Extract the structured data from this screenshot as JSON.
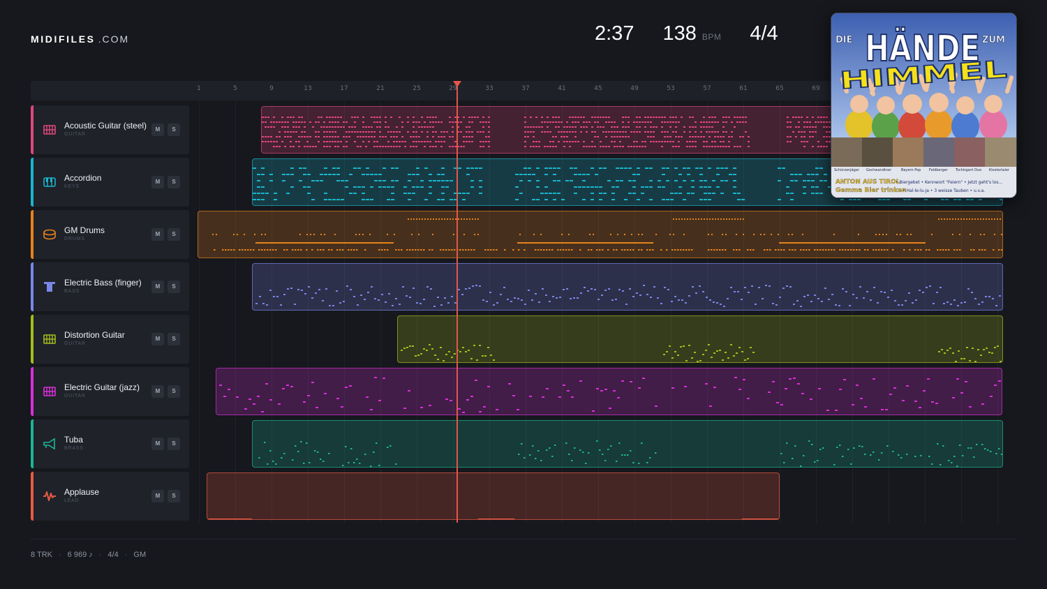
{
  "brand": {
    "name": "MIDIFILES",
    "domain": ".COM"
  },
  "transport": {
    "time": "2:37",
    "bpm": "138",
    "bpm_unit": "BPM",
    "signature": "4/4"
  },
  "album": {
    "title_top_left": "DIE",
    "title_main": "HÄNDE",
    "title_top_right": "ZUM",
    "title_bottom": "HIMMEL",
    "artists": [
      "Schürzenjäger",
      "Gschwandtner",
      "Bayern Pop",
      "Feldberger",
      "Tschirgant Duo",
      "Klostertaler"
    ],
    "tagline_1_lead": "ANTON AUS TIROL",
    "tagline_1_rest": "• Biergebet • Kennwort \"Feiern\" • Jetzt geht's los...",
    "tagline_2_lead": "Gemma Bier trinken",
    "tagline_2_rest": "• Hal-le-lu-ja • 3 weisse Tauben • u.v.a."
  },
  "ruler": {
    "ticks": [
      "1",
      "5",
      "9",
      "13",
      "17",
      "21",
      "25",
      "29",
      "33",
      "37",
      "41",
      "45",
      "49",
      "53",
      "57",
      "61",
      "65",
      "69"
    ]
  },
  "playhead": {
    "bar": 29
  },
  "tracks": [
    {
      "name": "Acoustic Guitar (steel)",
      "category": "GUITAR",
      "color": "#e0477c",
      "icon": "guitar-icon",
      "mute": "M",
      "solo": "S"
    },
    {
      "name": "Accordion",
      "category": "KEYS",
      "color": "#19b5cc",
      "icon": "keys-icon",
      "mute": "M",
      "solo": "S"
    },
    {
      "name": "GM Drums",
      "category": "DRUMS",
      "color": "#e8821d",
      "icon": "drum-icon",
      "mute": "M",
      "solo": "S"
    },
    {
      "name": "Electric Bass (finger)",
      "category": "BASS",
      "color": "#7a86e8",
      "icon": "bass-icon",
      "mute": "M",
      "solo": "S"
    },
    {
      "name": "Distortion Guitar",
      "category": "GUITAR",
      "color": "#a4bd1c",
      "icon": "guitar-icon",
      "mute": "M",
      "solo": "S"
    },
    {
      "name": "Electric Guitar (jazz)",
      "category": "GUITAR",
      "color": "#d92fd9",
      "icon": "guitar-icon",
      "mute": "M",
      "solo": "S"
    },
    {
      "name": "Tuba",
      "category": "BRASS",
      "color": "#1bb594",
      "icon": "brass-icon",
      "mute": "M",
      "solo": "S"
    },
    {
      "name": "Applause",
      "category": "LEAD",
      "color": "#e85a44",
      "icon": "wave-icon",
      "mute": "M",
      "solo": "S"
    }
  ],
  "footer": {
    "tracks": "8 TRK",
    "notes": "6 969 ♪",
    "signature": "4/4",
    "standard": "GM"
  }
}
